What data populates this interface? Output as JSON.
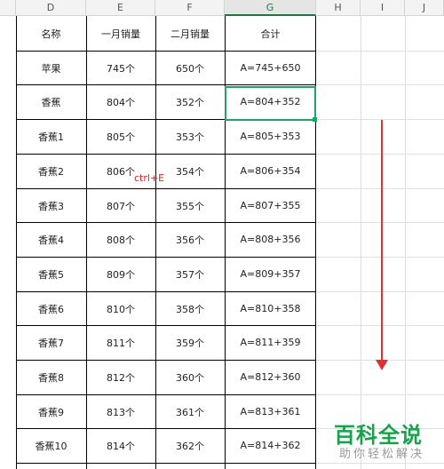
{
  "columns": [
    "D",
    "E",
    "F",
    "G",
    "H",
    "I",
    "J"
  ],
  "header_row": {
    "name": "名称",
    "jan": "一月销量",
    "feb": "二月销量",
    "total": "合计"
  },
  "rows": [
    {
      "name": "苹果",
      "jan": "745个",
      "feb": "650个",
      "total": "A=745+650"
    },
    {
      "name": "香蕉",
      "jan": "804个",
      "feb": "352个",
      "total": "A=804+352"
    },
    {
      "name": "香蕉1",
      "jan": "805个",
      "feb": "353个",
      "total": "A=805+353"
    },
    {
      "name": "香蕉2",
      "jan": "806个",
      "feb": "354个",
      "total": "A=806+354"
    },
    {
      "name": "香蕉3",
      "jan": "807个",
      "feb": "355个",
      "total": "A=807+355"
    },
    {
      "name": "香蕉4",
      "jan": "808个",
      "feb": "356个",
      "total": "A=808+356"
    },
    {
      "name": "香蕉5",
      "jan": "809个",
      "feb": "357个",
      "total": "A=809+357"
    },
    {
      "name": "香蕉6",
      "jan": "810个",
      "feb": "358个",
      "total": "A=810+358"
    },
    {
      "name": "香蕉7",
      "jan": "811个",
      "feb": "359个",
      "total": "A=811+359"
    },
    {
      "name": "香蕉8",
      "jan": "812个",
      "feb": "360个",
      "total": "A=812+360"
    },
    {
      "name": "香蕉9",
      "jan": "813个",
      "feb": "361个",
      "total": "A=813+361"
    },
    {
      "name": "香蕉10",
      "jan": "814个",
      "feb": "362个",
      "total": "A=814+362"
    }
  ],
  "annotation": {
    "shortcut": "ctrl+E"
  },
  "watermark": {
    "main": "百科全说",
    "sub": "助你轻松解决",
    "color": "#17a34a"
  },
  "colors": {
    "selection": "#21a366",
    "arrow": "#e03030",
    "note": "#e02020"
  }
}
